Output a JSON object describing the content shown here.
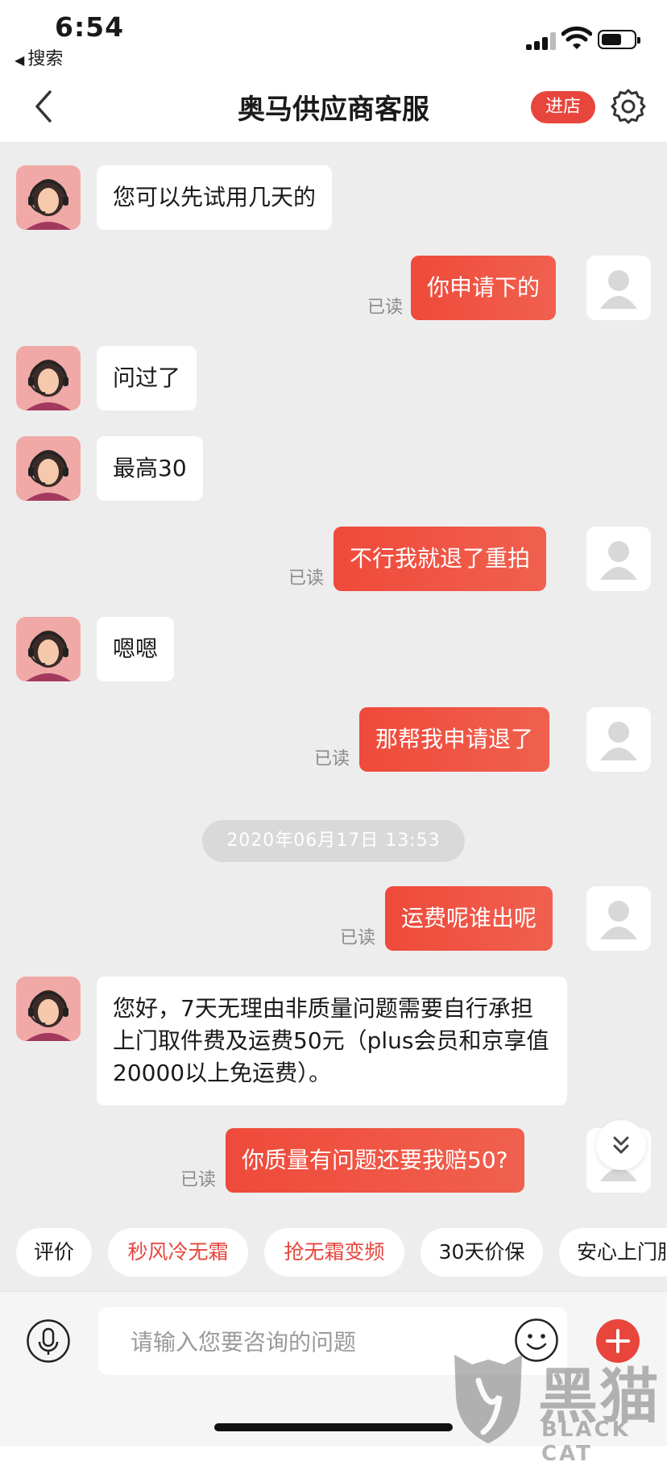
{
  "status_bar": {
    "time": "6:54",
    "back_app": "搜索"
  },
  "nav": {
    "title": "奥马供应商客服",
    "shop_button": "进店"
  },
  "read_label": "已读",
  "messages": [
    {
      "side": "in",
      "text": "您可以先试用几天的"
    },
    {
      "side": "out",
      "text": "你申请下的",
      "read": "已读"
    },
    {
      "side": "in",
      "text": "问过了"
    },
    {
      "side": "in",
      "text": "最高30"
    },
    {
      "side": "out",
      "text": "不行我就退了重拍",
      "read": "已读"
    },
    {
      "side": "in",
      "text": "嗯嗯"
    },
    {
      "side": "out",
      "text": "那帮我申请退了",
      "read": "已读"
    },
    {
      "side": "out",
      "text": "运费呢谁出呢",
      "read": "已读"
    },
    {
      "side": "in",
      "text": "您好，7天无理由非质量问题需要自行承担上门取件费及运费50元（plus会员和京享值20000以上免运费）。"
    },
    {
      "side": "out",
      "text": "你质量有问题还要我赔50?",
      "read": "已读"
    }
  ],
  "timestamp": "2020年06月17日 13:53",
  "quick_tags": [
    {
      "label": "评价",
      "color": "#1a1a1a"
    },
    {
      "label": "秒风冷无霜",
      "color": "#e8453c"
    },
    {
      "label": "抢无霜变频",
      "color": "#e8453c"
    },
    {
      "label": "30天价保",
      "color": "#1a1a1a"
    },
    {
      "label": "安心上门服",
      "color": "#1a1a1a"
    }
  ],
  "input": {
    "placeholder": "请输入您要咨询的问题",
    "value": ""
  },
  "watermark": {
    "cn": "黑猫",
    "en": "BLACK CAT"
  },
  "icons": [
    "chevron-left-icon",
    "gear-icon",
    "headset-avatar-icon",
    "user-avatar-icon",
    "chevron-double-down-icon",
    "microphone-icon",
    "smiley-icon",
    "plus-icon",
    "cat-logo-icon"
  ],
  "colors": {
    "accent": "#e8453c",
    "chat_bg": "#ededed",
    "bubble_in": "#ffffff",
    "read_text": "#8a8a8a"
  }
}
